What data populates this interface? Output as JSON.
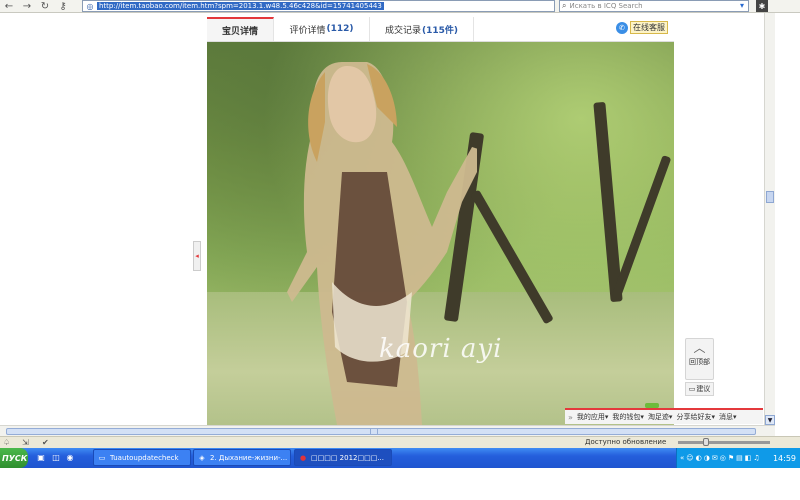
{
  "browser": {
    "url": "http://item.taobao.com/item.htm?spm=2013.1.w48.5.46c428&id=15741405443",
    "search_placeholder": "Искать в ICQ Search",
    "back_icon": "←",
    "forward_icon": "→",
    "reload_icon": "↻",
    "key_icon": "⚷",
    "site_icon": "◎",
    "search_icon": "⌕",
    "search_go_icon": "▾",
    "addon_icon": "✱"
  },
  "tabs": [
    {
      "label": "宝贝详情",
      "count": ""
    },
    {
      "label": "评价详情",
      "count": "(112)"
    },
    {
      "label": "成交记录",
      "count": "(115件)"
    }
  ],
  "contact": {
    "label": "在线客服",
    "icon": "✆"
  },
  "watermark": "kaori ayi",
  "side_handle_icon": "◂",
  "back_to_top": {
    "arrow": "︿",
    "label": "回顶部"
  },
  "suggest": {
    "icon": "▭",
    "label": "建议"
  },
  "taobao_bar": {
    "grip": "»",
    "items": [
      "我的应用▾",
      "我的钱包▾",
      "淘足迹▾",
      "分享给好友▾",
      "消息▾"
    ]
  },
  "status": {
    "update_text": "Доступно обновление",
    "icons": [
      "♤",
      "⇲",
      "✔"
    ]
  },
  "taskbar": {
    "start": "ПУСК",
    "quicklaunch": [
      "▣",
      "◫",
      "◉"
    ],
    "buttons": [
      {
        "icon": "▭",
        "label": "Tuautoupdatecheck"
      },
      {
        "icon": "◈",
        "label": "2. Дыхание-жизни-..."
      },
      {
        "icon": "●",
        "label": "□□□□ 2012□□□..."
      }
    ],
    "tray_icons": [
      "☺",
      "◐",
      "◑",
      "✉",
      "◎",
      "⚑",
      "▤",
      "◧",
      "◂",
      "♫"
    ],
    "tray_lang": "«",
    "clock": "14:59"
  },
  "colors": {
    "accent": "#e4393c",
    "link": "#2a5aa8",
    "taskbar": "#245edc",
    "tray": "#0f9ae8"
  }
}
